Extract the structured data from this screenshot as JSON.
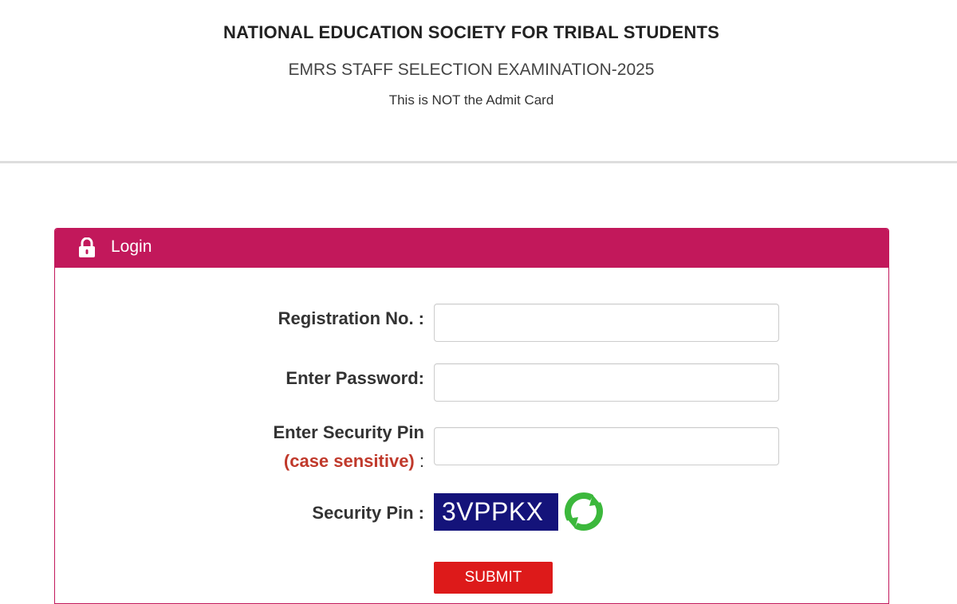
{
  "header": {
    "org_title": "NATIONAL EDUCATION SOCIETY FOR TRIBAL STUDENTS",
    "exam_title": "EMRS STAFF SELECTION EXAMINATION-2025",
    "notice": "This is NOT the Admit Card"
  },
  "login": {
    "panel_title": "Login",
    "panel_icon": "lock-icon",
    "registration_label": "Registration No. :",
    "registration_value": "",
    "password_label": "Enter Password:",
    "password_value": "",
    "security_pin_label_line1": "Enter Security Pin",
    "security_pin_label_case": "(case sensitive)",
    "security_pin_label_colon": " :",
    "security_pin_value": "",
    "captcha_label": "Security Pin :",
    "captcha_text": "3VPPKX",
    "refresh_icon": "refresh-icon",
    "submit_label": "SUBMIT"
  },
  "colors": {
    "accent": "#c2185b",
    "submit": "#dd1a1a",
    "captcha_bg": "#14137a",
    "case_note": "#c0392b",
    "refresh": "#3cb83c"
  }
}
